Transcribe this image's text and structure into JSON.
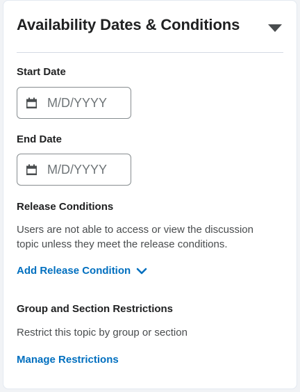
{
  "panel": {
    "title": "Availability Dates & Conditions",
    "toggle_icon": "caret-down-icon"
  },
  "start_date": {
    "label": "Start Date",
    "value": "",
    "placeholder": "M/D/YYYY",
    "icon": "calendar-icon"
  },
  "end_date": {
    "label": "End Date",
    "value": "",
    "placeholder": "M/D/YYYY",
    "icon": "calendar-icon"
  },
  "release_conditions": {
    "heading": "Release Conditions",
    "description": "Users are not able to access or view the discussion topic unless they meet the release conditions.",
    "add_link": "Add Release Condition",
    "add_link_icon": "chevron-down-icon"
  },
  "restrictions": {
    "heading": "Group and Section Restrictions",
    "description": "Restrict this topic by group or section",
    "manage_link": "Manage Restrictions"
  },
  "colors": {
    "link": "#006fbf",
    "text": "#202122",
    "muted_text": "#494c4e",
    "border": "#868c8f",
    "background": "#f1f3f6"
  }
}
